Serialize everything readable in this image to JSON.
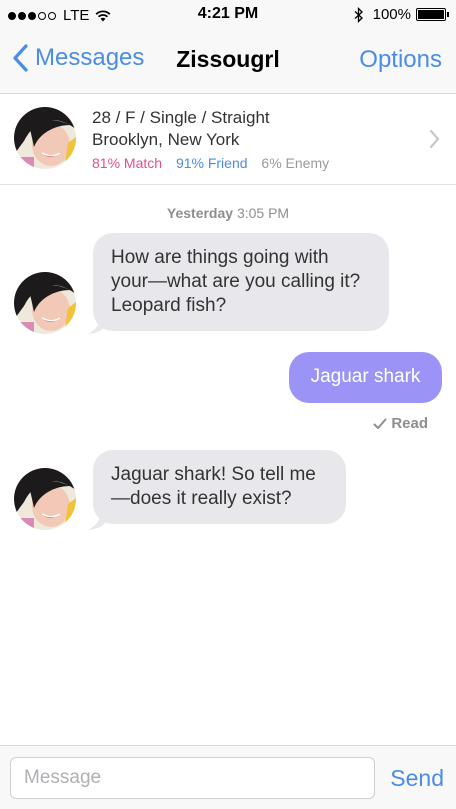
{
  "status_bar": {
    "carrier": "LTE",
    "time": "4:21 PM",
    "battery_percent": "100%",
    "signal_bars": 3,
    "battery_level": 1.0
  },
  "nav": {
    "back_label": "Messages",
    "title": "Zissougrl",
    "options_label": "Options"
  },
  "profile": {
    "details": "28 / F / Single / Straight",
    "location": "Brooklyn, New York",
    "match": "81% Match",
    "friend": "91% Friend",
    "enemy": "6% Enemy"
  },
  "conversation": {
    "timestamp_day": "Yesterday",
    "timestamp_time": "3:05 PM",
    "messages": [
      {
        "direction": "incoming",
        "lines": [
          "How are things going with",
          "your—what are you calling it?",
          "Leopard fish?"
        ]
      },
      {
        "direction": "outgoing",
        "lines": [
          "Jaguar shark"
        ]
      },
      {
        "direction": "incoming",
        "lines": [
          "Jaguar shark! So tell me",
          "—does it really exist?"
        ]
      }
    ],
    "read_label": "Read"
  },
  "composer": {
    "placeholder": "Message",
    "send_label": "Send"
  },
  "colors": {
    "accent": "#4a8de8",
    "outgoing_bubble": "#9b93f5",
    "incoming_bubble": "#e8e8ec",
    "match": "#e0508b",
    "friend": "#4a8de8",
    "enemy": "#9a9a9a"
  },
  "icons": {
    "back": "chevron-left-icon",
    "disclosure": "chevron-right-icon",
    "read": "checkmark-icon",
    "wifi": "wifi-icon",
    "bluetooth": "bluetooth-icon",
    "battery": "battery-icon"
  }
}
